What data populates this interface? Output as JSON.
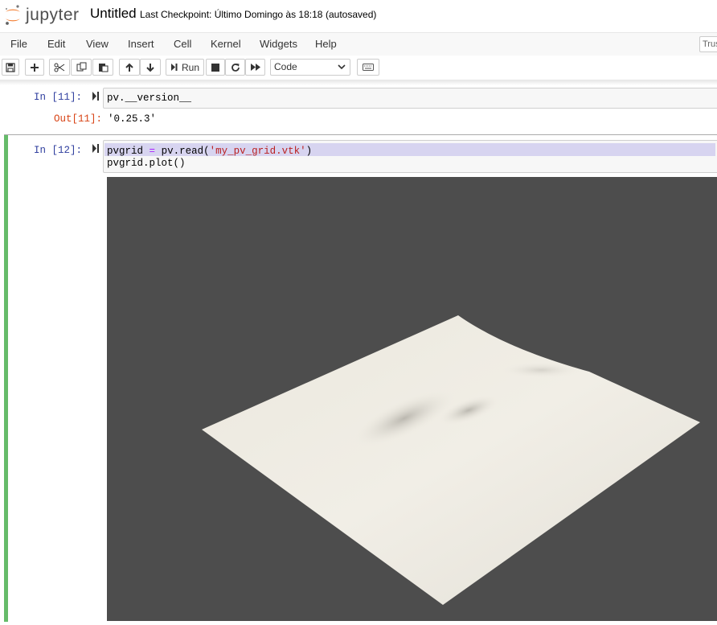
{
  "header": {
    "brand": "jupyter",
    "notebook_title": "Untitled",
    "checkpoint": "Last Checkpoint: Último Domingo às 18:18",
    "autosave_status": "(autosaved)"
  },
  "menubar": {
    "items": [
      "File",
      "Edit",
      "View",
      "Insert",
      "Cell",
      "Kernel",
      "Widgets",
      "Help"
    ],
    "trusted": "Trusted"
  },
  "toolbar": {
    "run_label": "Run",
    "cell_type": "Code",
    "icons": [
      "save-icon",
      "plus-icon",
      "cut-icon",
      "copy-icon",
      "paste-icon",
      "arrow-up-icon",
      "arrow-down-icon",
      "run-icon",
      "stop-icon",
      "restart-icon",
      "fast-forward-icon",
      "keyboard-icon"
    ]
  },
  "cells": [
    {
      "in_prompt": "In [11]:",
      "code": [
        "pv.__version__"
      ],
      "out_prompt": "Out[11]:",
      "output": "'0.25.3'"
    },
    {
      "in_prompt": "In [12]:",
      "code_line1": {
        "var": "pvgrid",
        "eq": "=",
        "call": "pv.read(",
        "arg": "'my_pv_grid.vtk'",
        "close": ")"
      },
      "code_line2": "pvgrid.plot()"
    }
  ],
  "plot": {
    "background": "#4d4d4d",
    "surface_color": "#eeebe2"
  },
  "colors": {
    "selected_cell_bar": "#66bb6a",
    "in_prompt": "#303f9f",
    "out_prompt": "#d84315",
    "logo_orange": "#f37726"
  }
}
